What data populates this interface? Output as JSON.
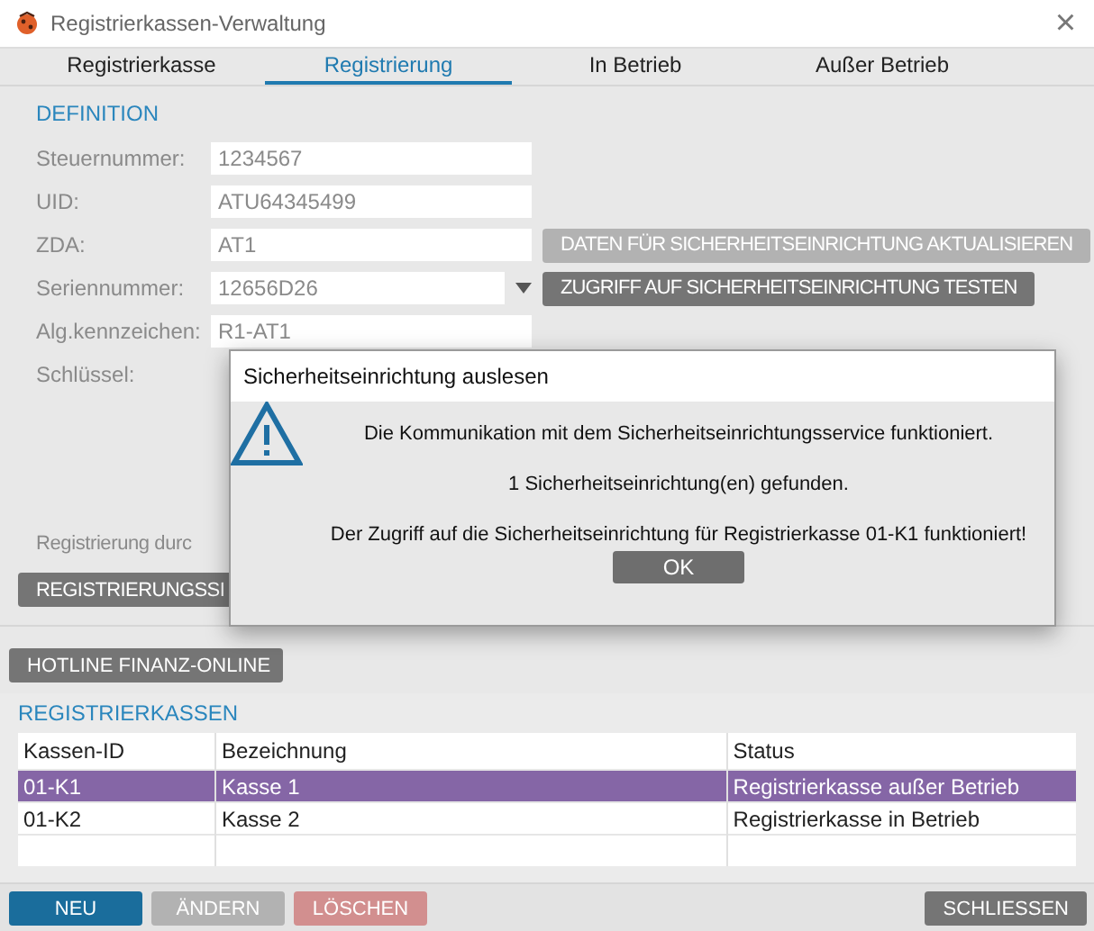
{
  "window": {
    "title": "Registrierkassen-Verwaltung",
    "close": "×"
  },
  "tabs": [
    {
      "label": "Registrierkasse",
      "selected": false
    },
    {
      "label": "Registrierung",
      "selected": true
    },
    {
      "label": "In Betrieb",
      "selected": false
    },
    {
      "label": "Außer Betrieb",
      "selected": false
    }
  ],
  "definition": {
    "heading": "DEFINITION",
    "fields": [
      {
        "kind": "text",
        "label": "Steuernummer:",
        "value": "1234567"
      },
      {
        "kind": "text",
        "label": "UID:",
        "value": "ATU64345499"
      },
      {
        "kind": "text",
        "label": "ZDA:",
        "value": "AT1",
        "action": {
          "label": "DATEN FÜR SICHERHEITSEINRICHTUNG AKTUALISIEREN",
          "disabled": true
        }
      },
      {
        "kind": "dropdown",
        "label": "Seriennummer:",
        "value": "12656D26",
        "action": {
          "label": "ZUGRIFF AUF SICHERHEITSEINRICHTUNG TESTEN",
          "disabled": false
        }
      },
      {
        "kind": "text",
        "label": "Alg.kennzeichen:",
        "value": "R1-AT1"
      },
      {
        "kind": "label",
        "label": "Schlüssel:"
      }
    ],
    "note": "Registrierung durc",
    "button": "REGISTRIERUNGSSI"
  },
  "hotline_button": "HOTLINE FINANZ-ONLINE",
  "registrierkassen": {
    "heading": "REGISTRIERKASSEN",
    "columns": [
      "Kassen-ID",
      "Bezeichnung",
      "Status"
    ],
    "rows": [
      {
        "cells": [
          "01-K1",
          "Kasse 1",
          "Registrierkasse außer Betrieb"
        ],
        "selected": true
      },
      {
        "cells": [
          "01-K2",
          "Kasse 2",
          "Registrierkasse in Betrieb"
        ],
        "selected": false
      }
    ]
  },
  "footer_buttons": [
    {
      "label": "NEU",
      "kind": "primary",
      "disabled": false
    },
    {
      "label": "ÄNDERN",
      "kind": "default",
      "disabled": true
    },
    {
      "label": "LÖSCHEN",
      "kind": "danger",
      "disabled": true
    },
    {
      "label": "SCHLIESSEN",
      "kind": "default",
      "disabled": false
    }
  ],
  "dialog": {
    "title": "Sicherheitseinrichtung auslesen",
    "messages": [
      "Die Kommunikation mit dem Sicherheitseinrichtungsservice funktioniert.",
      "1 Sicherheitseinrichtung(en) gefunden.",
      "Der Zugriff auf die Sicherheitseinrichtung für Registrierkasse 01-K1 funktioniert!"
    ],
    "button": "OK"
  }
}
